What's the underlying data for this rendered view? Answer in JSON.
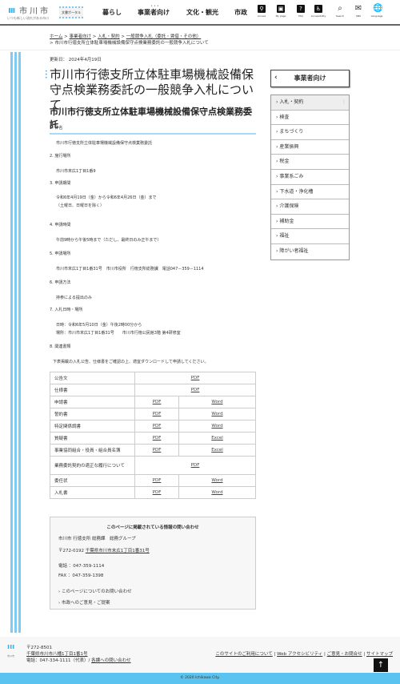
{
  "header": {
    "logo_name": "市川市",
    "logo_tagline": "いつも新しい流れがある市川",
    "portal": "文書ポータル",
    "nav": [
      "暮らし",
      "事業者向け",
      "文化・観光",
      "市政"
    ],
    "icons": [
      {
        "name": "access-icon",
        "label": "Access",
        "glyph": "⚲"
      },
      {
        "name": "mypage-icon",
        "label": "My page",
        "glyph": "▣"
      },
      {
        "name": "faq-icon",
        "label": "FAQ",
        "glyph": "?"
      },
      {
        "name": "accessibility-icon",
        "label": "Accessibility",
        "glyph": "♿"
      },
      {
        "name": "search-icon",
        "label": "Search",
        "glyph": "⌕"
      },
      {
        "name": "sns-icon",
        "label": "SNS",
        "glyph": "✉"
      },
      {
        "name": "language-icon",
        "label": "Language",
        "glyph": "🌐"
      }
    ]
  },
  "breadcrumb": [
    "ホーム",
    "事業者向け",
    "入札・契約",
    "一般競争入札（委託・賃借・その他）",
    "市川市行徳支所立体駐車場機械設備保守点検業務委託の一般競争入札について"
  ],
  "updated": "更新日： 2024年4月19日",
  "title": "市川市行徳支所立体駐車場機械設備保守点検業務委託の一般競争入札について",
  "subtitle": "市川市行徳支所立体駐車場機械設備保守点検業務委託",
  "sections": [
    {
      "h": "1. 件名",
      "lines": [
        "市川市行徳支所立体駐車場機械設備保守点検業務委託"
      ]
    },
    {
      "h": "2. 施行場所",
      "lines": [
        "市川市末広1丁目1番9"
      ]
    },
    {
      "h": "3. 申請期間",
      "lines": [
        "令和6年4月19日（金）から令和6年4月26日（金）まで",
        "（土曜日、日曜日を除く）"
      ]
    },
    {
      "h": "4. 申請時間",
      "lines": [
        "午前9時から午後5時まで（ただし、最終日のみ正午まで）"
      ]
    },
    {
      "h": "5. 申請場所",
      "lines": [
        "市川市末広1丁目1番31号　市川市役所　行徳支所総務課　電話047－359－1114"
      ]
    },
    {
      "h": "6. 申請方法",
      "lines": [
        "持参による提出のみ"
      ]
    },
    {
      "h": "7. 入札日時・場所",
      "lines": [
        "日時：令和6年5月10日（金）午後2時00分から",
        "場所：市川市末広1丁目1番31号　　市川市行徳公民館3階 第4研修室"
      ]
    },
    {
      "h": "8. 関連書類",
      "lines": [
        "下表掲載の入札公告、仕様書をご確認の上、適宜ダウンロードして申請してください。"
      ]
    }
  ],
  "table": [
    {
      "label": "公告文",
      "links": [
        "PDF"
      ]
    },
    {
      "label": "仕様書",
      "links": [
        "PDF"
      ]
    },
    {
      "label": "申請書",
      "links": [
        "PDF",
        "Word"
      ]
    },
    {
      "label": "誓約書",
      "links": [
        "PDF",
        "Word"
      ]
    },
    {
      "label": "特定関係調書",
      "links": [
        "PDF",
        "Word"
      ]
    },
    {
      "label": "質疑書",
      "links": [
        "PDF",
        "Excel"
      ]
    },
    {
      "label": "事業協同組合・役員・組合員名簿",
      "links": [
        "PDF",
        "Excel"
      ]
    },
    {
      "label": "業務委託契約の適正な履行について",
      "links": [
        "PDF"
      ]
    },
    {
      "label": "委任状",
      "links": [
        "PDF",
        "Word"
      ]
    },
    {
      "label": "入札書",
      "links": [
        "PDF",
        "Word"
      ]
    }
  ],
  "contact": {
    "heading": "このページに掲載されている情報の問い合わせ",
    "dept": "市川市 行徳支所 総務課　総務グループ",
    "postal": "〒272-0192",
    "address": "千葉県市川市末広1丁目1番31号",
    "tel": "電話 ：047-359-1114",
    "fax": "FAX ：047-359-1398",
    "links": [
      "このページについてのお問い合わせ",
      "市政へのご意見・ご提案"
    ]
  },
  "sidebar": {
    "heading": "事業者向け",
    "items": [
      "入札・契約",
      "検査",
      "まちづくり",
      "産業振興",
      "税金",
      "事業系ごみ",
      "下水道・浄化槽",
      "介護保険",
      "補助金",
      "福祉",
      "障がい者福祉"
    ]
  },
  "footer": {
    "logo": "市川市",
    "postal": "〒272-8501",
    "address": "千葉県市川市八幡1丁目1番1号",
    "tel": "電話：047-334-1111（代表）/",
    "contact_link": "各課への問い合わせ",
    "links": [
      "このサイトのご利用について",
      "Web アクセシビリティ",
      "ご意見・お問合せ",
      "サイトマップ"
    ],
    "copyright": "© 2020 Ichikawa City."
  },
  "colors": {
    "accent": "#5bc3f0",
    "stripe": "#7cccf5"
  }
}
